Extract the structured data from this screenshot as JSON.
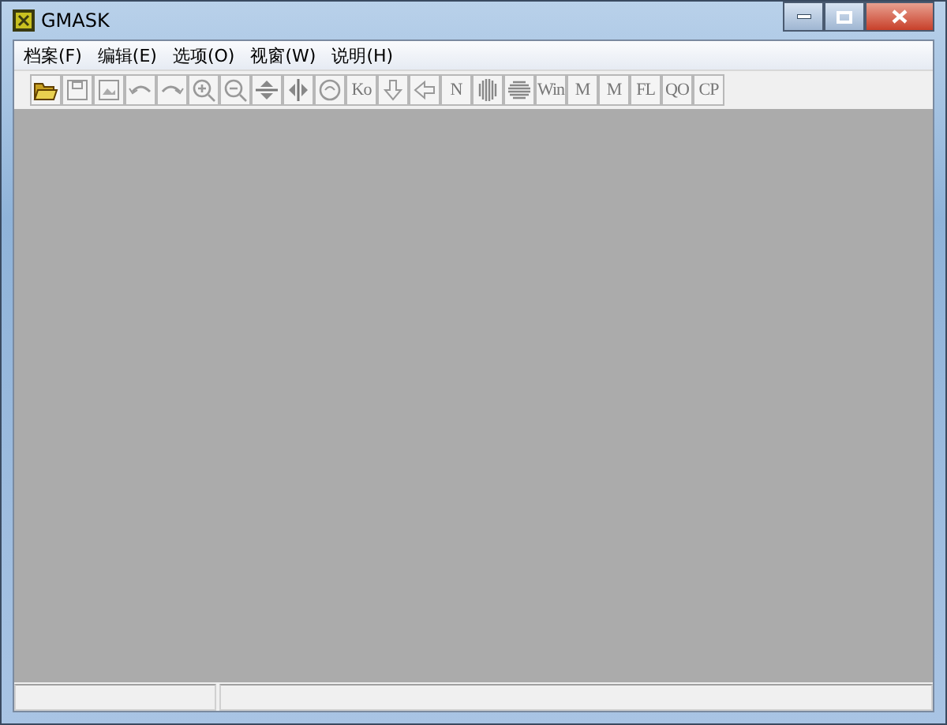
{
  "window": {
    "title": "GMASK"
  },
  "menu": [
    "档案(F)",
    "编辑(E)",
    "选项(O)",
    "视窗(W)",
    "说明(H)"
  ],
  "toolbar": [
    {
      "kind": "folder"
    },
    {
      "kind": "save"
    },
    {
      "kind": "picture"
    },
    {
      "kind": "undo"
    },
    {
      "kind": "redo"
    },
    {
      "kind": "zoom-in"
    },
    {
      "kind": "zoom-out"
    },
    {
      "kind": "flip-v"
    },
    {
      "kind": "flip-h"
    },
    {
      "kind": "rotate"
    },
    {
      "kind": "text",
      "label": "Ko"
    },
    {
      "kind": "arrow-down"
    },
    {
      "kind": "arrow-left"
    },
    {
      "kind": "text",
      "label": "N"
    },
    {
      "kind": "bars-v"
    },
    {
      "kind": "bars-h"
    },
    {
      "kind": "text",
      "label": "Win"
    },
    {
      "kind": "text",
      "label": "M"
    },
    {
      "kind": "text",
      "label": "M"
    },
    {
      "kind": "text",
      "label": "FL"
    },
    {
      "kind": "text",
      "label": "QO"
    },
    {
      "kind": "text",
      "label": "CP"
    }
  ]
}
